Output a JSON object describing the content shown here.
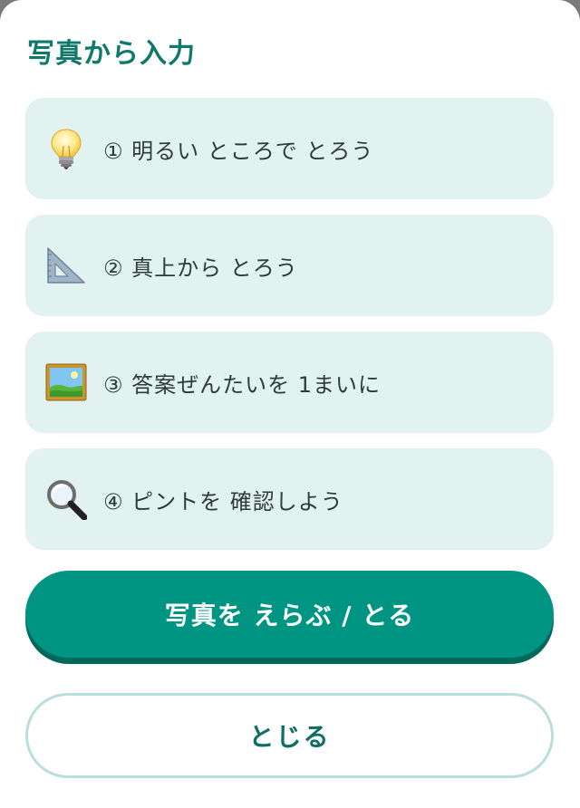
{
  "dialog": {
    "title": "写真から入力"
  },
  "tips": [
    {
      "icon": "light-bulb-icon",
      "text": "① 明るい ところで とろう"
    },
    {
      "icon": "triangle-ruler-icon",
      "text": "② 真上から とろう"
    },
    {
      "icon": "framed-picture-icon",
      "text": "③ 答案ぜんたいを 1まいに"
    },
    {
      "icon": "magnifying-glass-icon",
      "text": "④ ピントを 確認しよう"
    }
  ],
  "actions": {
    "select_photo_label": "写真を えらぶ / とる",
    "close_label": "とじる"
  },
  "colors": {
    "accent": "#009583",
    "accent_shadow": "#00695c",
    "title": "#0f7a6c",
    "tip_background": "#e1f2f1",
    "close_border": "#b9dfdc"
  }
}
